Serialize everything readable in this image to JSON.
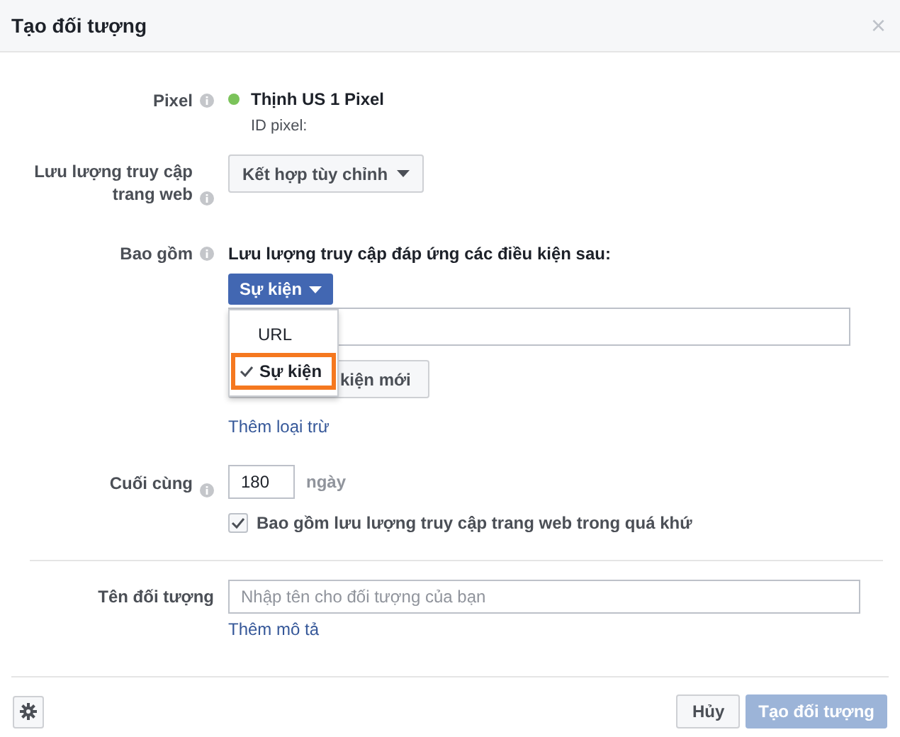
{
  "dialog": {
    "title": "Tạo đối tượng",
    "close": "×"
  },
  "pixel": {
    "label": "Pixel",
    "name": "Thịnh US 1 Pixel",
    "id_label": "ID pixel:",
    "active": true
  },
  "traffic": {
    "label": "Lưu lượng truy cập trang web",
    "value": "Kết hợp tùy chỉnh"
  },
  "include": {
    "label": "Bao gồm",
    "heading": "Lưu lượng truy cập đáp ứng các điều kiện sau:",
    "type_button": "Sự kiện",
    "menu": [
      {
        "label": "URL",
        "selected": false,
        "highlighted": false
      },
      {
        "label": "Sự kiện",
        "selected": true,
        "highlighted": true
      }
    ],
    "add_condition_button": "kiện mới",
    "exclude_link": "Thêm loại trừ"
  },
  "duration": {
    "label": "Cuối cùng",
    "value": "180",
    "unit": "ngày"
  },
  "past_traffic": {
    "label": "Bao gồm lưu lượng truy cập trang web trong quá khứ",
    "checked": true
  },
  "audience_name": {
    "label": "Tên đối tượng",
    "placeholder": "Nhập tên cho đối tượng của bạn",
    "description_link": "Thêm mô tả"
  },
  "footer": {
    "cancel": "Hủy",
    "create": "Tạo đối tượng",
    "create_disabled": true
  }
}
